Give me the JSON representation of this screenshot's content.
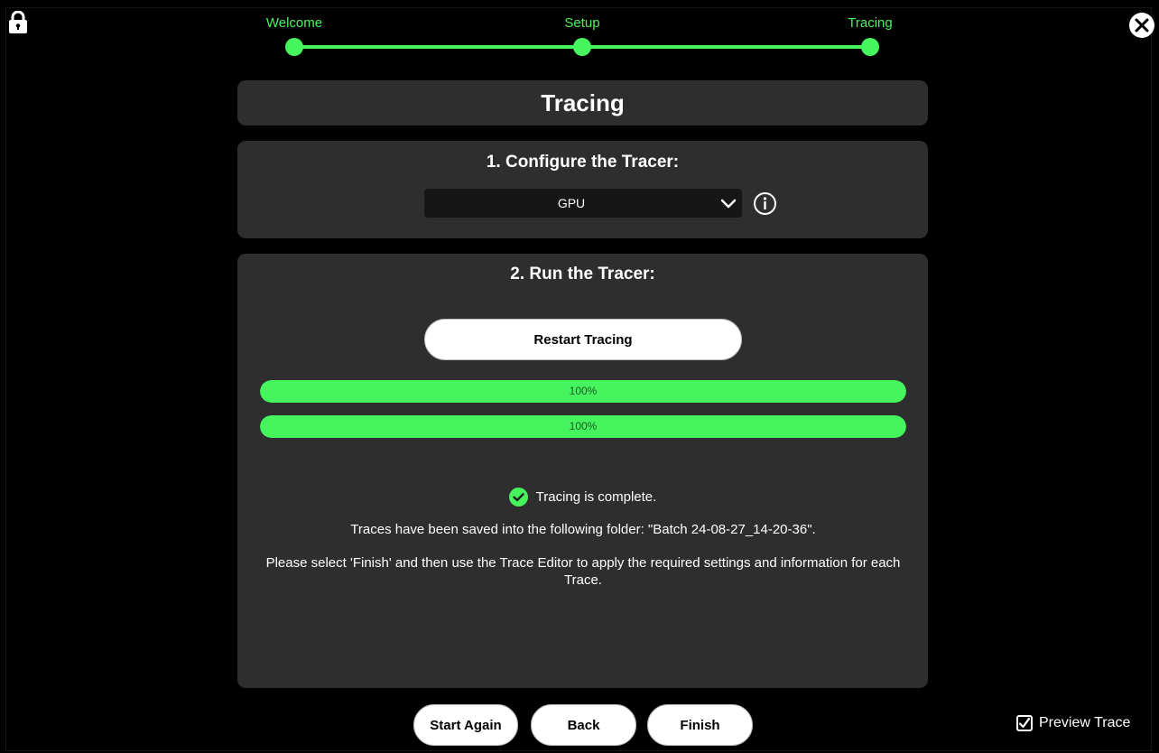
{
  "stepper": {
    "steps": [
      {
        "label": "Welcome"
      },
      {
        "label": "Setup"
      },
      {
        "label": "Tracing"
      }
    ],
    "current": "Tracing",
    "accent_color": "#46f45e"
  },
  "page_title": "Tracing",
  "configure": {
    "heading": "1. Configure the Tracer:",
    "tracer_selected": "GPU",
    "icons": {
      "dropdown": "chevron-down-icon",
      "info": "info-icon"
    }
  },
  "run": {
    "heading": "2. Run the Tracer:",
    "restart_label": "Restart Tracing",
    "progress": [
      {
        "label": "100%",
        "percent": 100
      },
      {
        "label": "100%",
        "percent": 100
      }
    ],
    "status_text": "Tracing is complete.",
    "saved_message": "Traces have been saved into the following folder: \"Batch 24-08-27_14-20-36\".",
    "instructions": "Please select 'Finish' and then use the Trace Editor to apply the required settings and information for each Trace."
  },
  "footer": {
    "start_again_label": "Start Again",
    "back_label": "Back",
    "finish_label": "Finish",
    "preview_trace_label": "Preview Trace",
    "preview_trace_checked": true
  },
  "icons": {
    "lock": "lock-icon",
    "close": "close-icon",
    "status": "check-circle-icon",
    "preview_checkbox": "checkbox-icon"
  }
}
